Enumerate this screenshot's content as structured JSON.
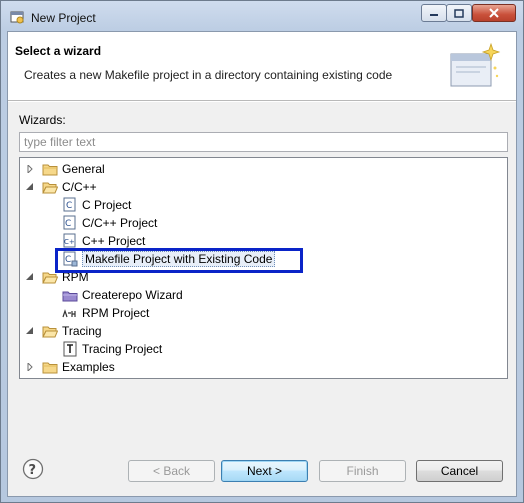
{
  "window": {
    "title": "New Project"
  },
  "banner": {
    "title": "Select a wizard",
    "description": "Creates a new Makefile project in a directory containing existing code"
  },
  "wizards_label": "Wizards:",
  "filter": {
    "placeholder": "type filter text",
    "value": ""
  },
  "tree": [
    {
      "label": "General",
      "expanded": false,
      "icon": "folder-icon"
    },
    {
      "label": "C/C++",
      "expanded": true,
      "icon": "folder-icon",
      "children": [
        "C Project",
        "C/C++ Project",
        "C++ Project",
        "Makefile Project with Existing Code"
      ]
    },
    {
      "label": "RPM",
      "expanded": true,
      "icon": "folder-icon",
      "children": [
        "Createrepo Wizard",
        "RPM Project"
      ]
    },
    {
      "label": "Tracing",
      "expanded": true,
      "icon": "folder-icon",
      "children": [
        "Tracing Project"
      ]
    },
    {
      "label": "Examples",
      "expanded": false,
      "icon": "folder-icon"
    }
  ],
  "selected_item": "Makefile Project with Existing Code",
  "buttons": {
    "back": "< Back",
    "next": "Next >",
    "finish": "Finish",
    "cancel": "Cancel"
  },
  "colors": {
    "highlight_box": "#0a24c8",
    "close_button": "#c9503a"
  }
}
